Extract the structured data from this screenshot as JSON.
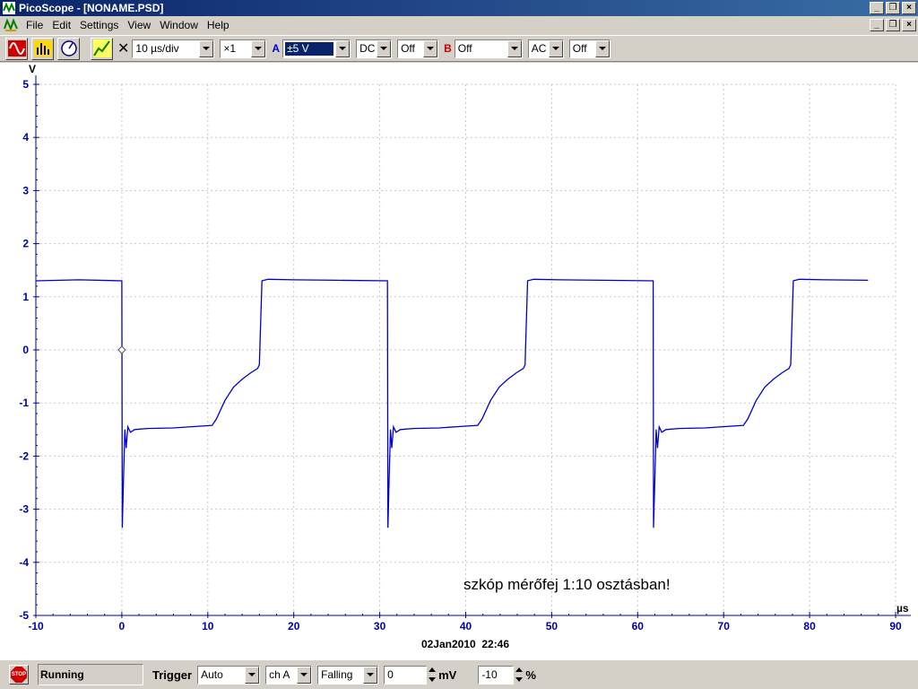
{
  "window": {
    "title": "PicoScope - [NONAME.PSD]",
    "controls": [
      "_",
      "❐",
      "×"
    ],
    "doc_controls": [
      "_",
      "❐",
      "×"
    ]
  },
  "menu": {
    "items": [
      "File",
      "Edit",
      "Settings",
      "View",
      "Window",
      "Help"
    ]
  },
  "toolbar": {
    "timebase": "10 µs/div",
    "multiplier": "×1",
    "channel_a": {
      "label": "A",
      "range": "±5 V",
      "coupling": "DC",
      "offset": "Off",
      "color": "#0000cc"
    },
    "channel_b": {
      "label": "B",
      "range": "Off",
      "coupling": "AC",
      "offset": "Off",
      "color": "#cc0000"
    }
  },
  "scope": {
    "y_unit": "V",
    "x_unit": "µs",
    "annotation": "szkóp mérőfej 1:10 osztásban!",
    "timestamp": "02Jan2010  22:46",
    "trace_color": "#0000cc",
    "axis_color": "#0000a0"
  },
  "chart_data": {
    "type": "line",
    "xlim": [
      -10,
      90
    ],
    "ylim": [
      -5,
      5
    ],
    "x_ticks": [
      "-10",
      "0",
      "10",
      "20",
      "30",
      "40",
      "50",
      "60",
      "70",
      "80",
      "90"
    ],
    "y_ticks": [
      "5",
      "4",
      "3",
      "2",
      "1",
      "0",
      "-1",
      "-2",
      "-3",
      "-4",
      "-5"
    ],
    "grid": true,
    "trigger_marker": {
      "x": 0,
      "y": 0
    },
    "period": 30.9,
    "series": [
      {
        "values_x": [
          -10,
          -5,
          0,
          0.05,
          0.2,
          0.35,
          0.5,
          0.7,
          1.0,
          1.5,
          3,
          6,
          10.5,
          11,
          12,
          13,
          14,
          15,
          15.8,
          16,
          16.3,
          17,
          20,
          25,
          30.9
        ],
        "values_y": [
          1.3,
          1.32,
          1.3,
          -3.35,
          -2.4,
          -1.5,
          -1.85,
          -1.45,
          -1.55,
          -1.5,
          -1.48,
          -1.47,
          -1.42,
          -1.3,
          -0.95,
          -0.7,
          -0.55,
          -0.43,
          -0.35,
          -0.28,
          1.3,
          1.33,
          1.32,
          1.31,
          1.3
        ]
      }
    ]
  },
  "status": {
    "state": "Running",
    "trigger_label": "Trigger",
    "trigger_mode": "Auto",
    "trigger_channel": "ch A",
    "trigger_edge": "Falling",
    "trigger_level": "0",
    "trigger_level_unit": "mV",
    "pretrigger": "-10",
    "pretrigger_unit": "%",
    "stop_label": "STOP"
  }
}
